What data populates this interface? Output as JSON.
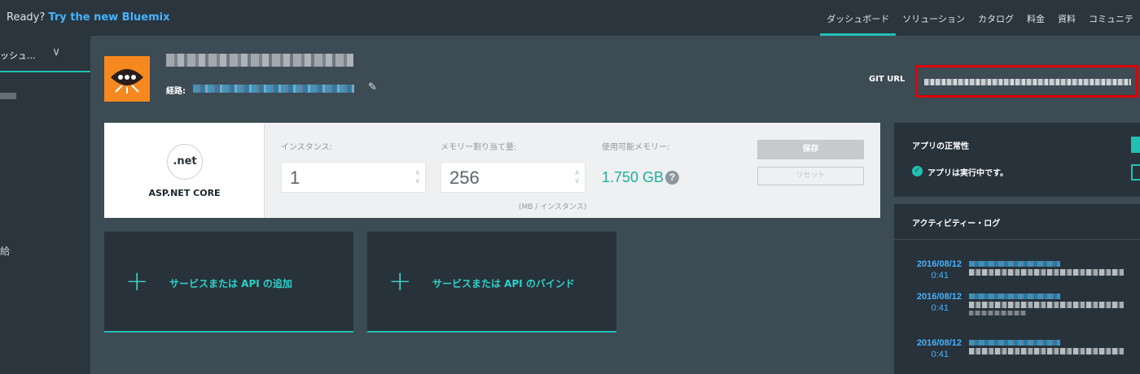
{
  "topbar": {
    "ready_text": "Ready?",
    "ready_link": "Try the new Bluemix",
    "nav": [
      "ダッシュボード",
      "ソリューション",
      "カタログ",
      "料金",
      "資料",
      "コミュニテ"
    ]
  },
  "sidebar": {
    "header_label": "ッシュ...",
    "item_2": "給"
  },
  "app": {
    "icon": "eye-icon",
    "route_label": "経路:",
    "git_label": "GIT URL"
  },
  "runtime": {
    "logo_text": ".net",
    "name": "ASP.NET CORE",
    "instances_label": "インスタンス:",
    "instances_value": "1",
    "memory_label": "メモリー割り当て量:",
    "memory_value": "256",
    "memory_unit": "(MB / インスタンス)",
    "available_label": "使用可能メモリー:",
    "available_value": "1.750 GB",
    "help_glyph": "?",
    "save_label": "保存",
    "reset_label": "リセット"
  },
  "services": [
    {
      "plus": "+",
      "label": "サービスまたは API の追加"
    },
    {
      "plus": "+",
      "label": "サービスまたは API のバインド"
    }
  ],
  "health": {
    "title": "アプリの正常性",
    "status": "アプリは実行中です。"
  },
  "activity": {
    "title": "アクティビティー・ログ",
    "entries": [
      {
        "date": "2016/08/12",
        "time": "0:41"
      },
      {
        "date": "2016/08/12",
        "time": "0:41"
      },
      {
        "date": "2016/08/12",
        "time": "0:41"
      }
    ]
  },
  "colors": {
    "accent": "#21c0b4",
    "link": "#46b3ff",
    "app_icon_bg": "#f5891f",
    "highlight_box": "#e00000"
  }
}
